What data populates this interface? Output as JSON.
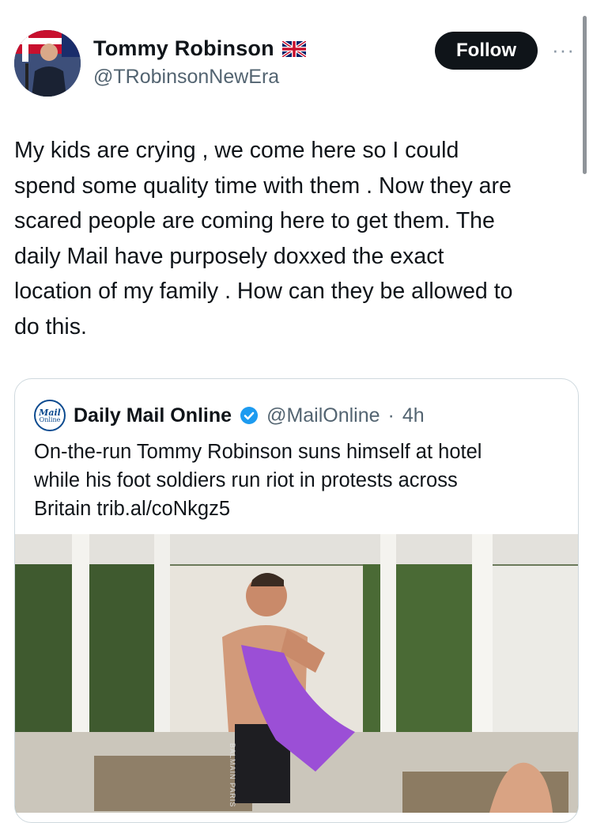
{
  "author": {
    "display_name": "Tommy Robinson",
    "flag_icon": "uk-flag-icon",
    "handle": "@TRobinsonNewEra"
  },
  "actions": {
    "follow_label": "Follow",
    "more_label": "···"
  },
  "tweet": {
    "text": "My kids are crying , we come here so I could\nspend some quality time with them . Now they are\nscared people are coming here to get them. The\ndaily Mail have purposely doxxed the exact\nlocation of my family . How can they be allowed to\ndo this."
  },
  "quoted_tweet": {
    "logo_line1": "Mail",
    "logo_line2": "Online",
    "display_name": "Daily Mail Online",
    "verified_icon": "verified-badge-icon",
    "handle": "@MailOnline",
    "separator": "·",
    "time": "4h",
    "text": "On-the-run Tommy Robinson suns himself at hotel\nwhile his foot soldiers run riot in protests across\nBritain trib.al/coNkgz5",
    "shorts_text": "BALMAIN PARIS"
  },
  "colors": {
    "text": "#0f1419",
    "secondary": "#536471",
    "border": "#cfd9de",
    "verified": "#1d9bf0",
    "towel": "#9b4fd6"
  }
}
